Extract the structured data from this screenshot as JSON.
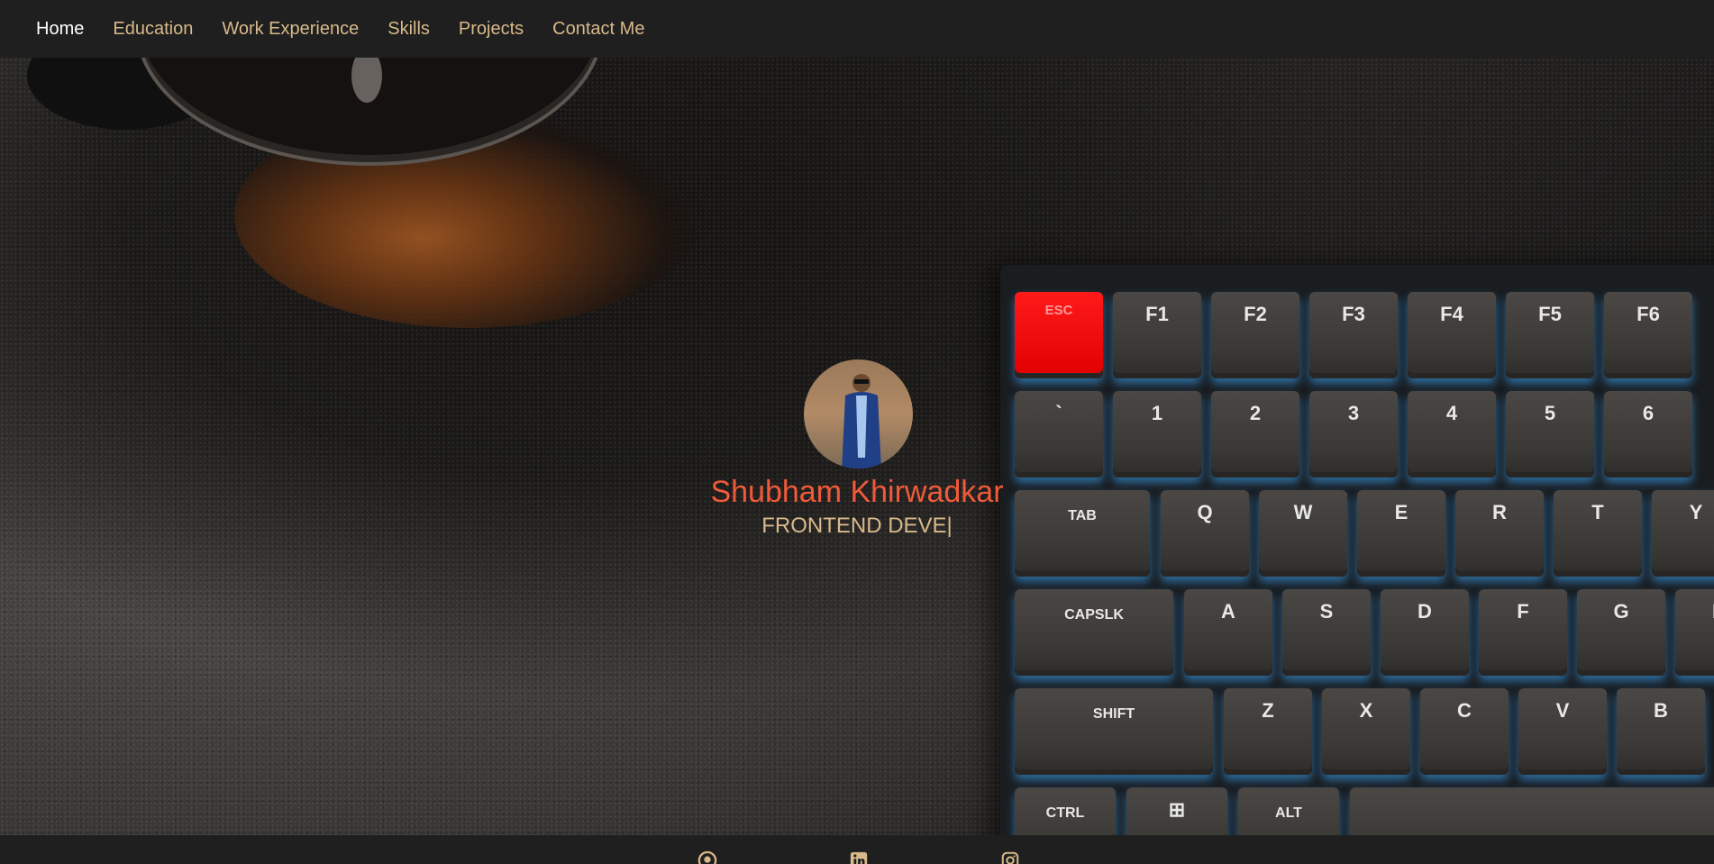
{
  "nav": {
    "items": [
      {
        "label": "Home",
        "active": true
      },
      {
        "label": "Education",
        "active": false
      },
      {
        "label": "Work Experience",
        "active": false
      },
      {
        "label": "Skills",
        "active": false
      },
      {
        "label": "Projects",
        "active": false
      },
      {
        "label": "Contact Me",
        "active": false
      }
    ]
  },
  "profile": {
    "name": "Shubham Khirwadkar",
    "role_typed": "FRONTEND DEVE|"
  },
  "keyboard": {
    "row1": [
      "ESC",
      "F1",
      "F2",
      "F3",
      "F4",
      "F5",
      "F6"
    ],
    "row2": [
      "`",
      "1",
      "2",
      "3",
      "4",
      "5",
      "6"
    ],
    "row3": [
      "TAB",
      "Q",
      "W",
      "E",
      "R",
      "T",
      "Y"
    ],
    "row4": [
      "CAPSLK",
      "A",
      "S",
      "D",
      "F",
      "G",
      "H"
    ],
    "row5": [
      "SHIFT",
      "Z",
      "X",
      "C",
      "V",
      "B"
    ],
    "row6": [
      "CTRL",
      "⊞",
      "ALT"
    ]
  },
  "social": {
    "icons": [
      "github-icon",
      "linkedin-icon",
      "instagram-icon"
    ]
  },
  "colors": {
    "nav_bg": "#1f1f1f",
    "nav_text": "#d8b98a",
    "nav_active": "#ffffff",
    "name": "#f05a3a",
    "role": "#d8b98a",
    "esc_key": "#e00000"
  }
}
